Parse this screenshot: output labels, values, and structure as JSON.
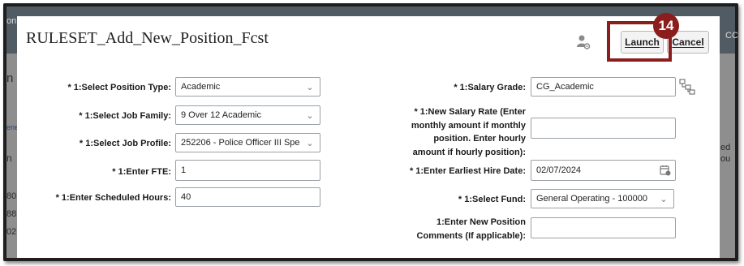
{
  "dialog": {
    "title": "RULESET_Add_New_Position_Fcst",
    "launch_label": "Launch",
    "cancel_label": "Cancel",
    "step_number": "14"
  },
  "background": {
    "left_fragments": [
      "on",
      "n",
      "ene",
      "n",
      "8",
      "80",
      "88",
      "02"
    ],
    "right_fragments": [
      "ed",
      "ou",
      "CC"
    ]
  },
  "form": {
    "left": [
      {
        "label": "* 1:Select Position Type:",
        "value": "Academic",
        "type": "select"
      },
      {
        "label": "* 1:Select Job Family:",
        "value": "9 Over 12  Academic",
        "type": "select"
      },
      {
        "label": "* 1:Select Job Profile:",
        "value": "252206 - Police Officer III Spe",
        "type": "select"
      },
      {
        "label": "* 1:Enter FTE:",
        "value": "1",
        "type": "text"
      },
      {
        "label": "* 1:Enter Scheduled Hours:",
        "value": "40",
        "type": "text"
      }
    ],
    "right": [
      {
        "label": "* 1:Salary Grade:",
        "value": "CG_Academic",
        "type": "text"
      },
      {
        "label_lines": [
          "* 1:New Salary Rate (Enter",
          "monthly amount if monthly",
          "position. Enter hourly",
          "amount if hourly position):"
        ],
        "value": "",
        "type": "text"
      },
      {
        "label": "* 1:Enter Earliest Hire Date:",
        "value": "02/07/2024",
        "type": "date"
      },
      {
        "label": "* 1:Select Fund:",
        "value": "General Operating - 100000",
        "type": "select"
      },
      {
        "label_lines": [
          "1:Enter New Position",
          "Comments (If applicable):"
        ],
        "value": "",
        "type": "text"
      }
    ]
  },
  "icons": {
    "user": "user-settings-icon",
    "hierarchy": "hierarchy-icon",
    "calendar": "calendar-icon",
    "chevron": "chevron-down-icon"
  }
}
